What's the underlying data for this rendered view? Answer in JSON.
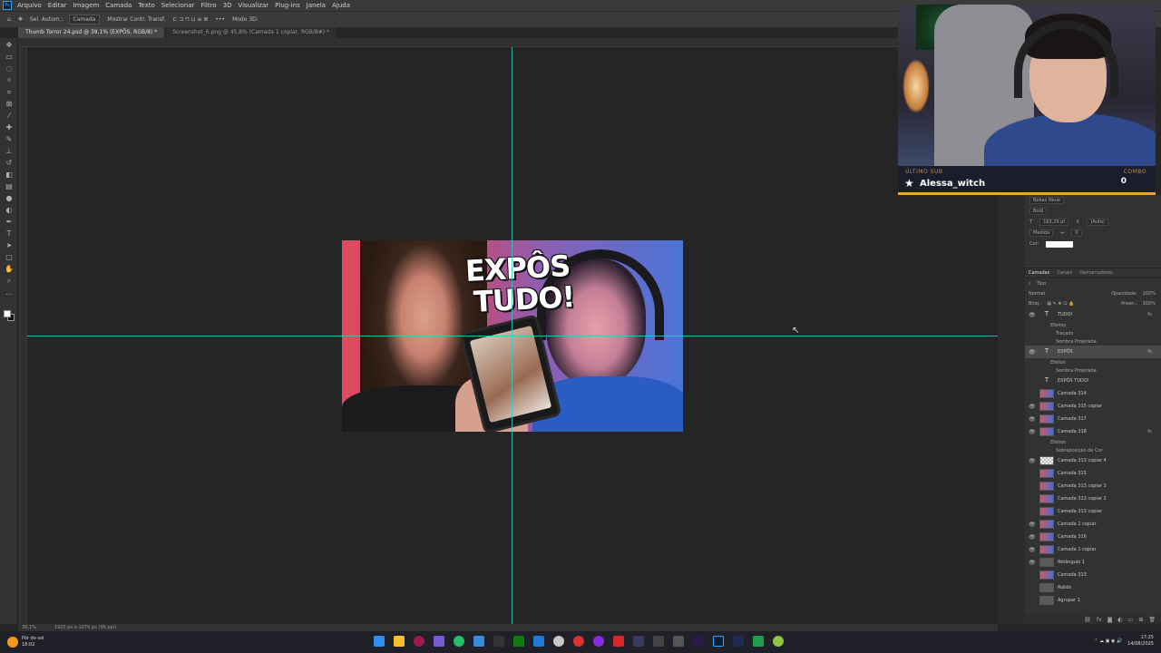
{
  "menubar": {
    "logo": "Ps",
    "items": [
      "Arquivo",
      "Editar",
      "Imagem",
      "Camada",
      "Texto",
      "Selecionar",
      "Filtro",
      "3D",
      "Visualizar",
      "Plug-ins",
      "Janela",
      "Ajuda"
    ]
  },
  "optionsbar": {
    "auto_select": "Sel. Autom.:",
    "auto_select_value": "Camada",
    "show_transform": "Mostrar Contr. Transf.",
    "mode_3d": "Modo 3D:"
  },
  "tabs": [
    {
      "label": "Thumb Torror 24.psd @ 39,1% (EXPÔS, RGB/8) *",
      "active": true
    },
    {
      "label": "Screenshot_6.png @ 45,8% (Camada 1 copiar, RGB/8#) *",
      "active": false
    }
  ],
  "canvas": {
    "headline_line1": "EXPÔS",
    "headline_line2": "TUDO!"
  },
  "statusbar": {
    "zoom": "39,1%",
    "doc_size": "1920 px x 1079 px (96 ppi)"
  },
  "stream_alert": {
    "label": "ÚLTIMO SUB",
    "name": "Alessa_witch",
    "combo_label": "COMBO",
    "combo_value": "0"
  },
  "properties": {
    "font_family": "Bebas Neue",
    "font_style": "Bold",
    "size": "163,29 pt",
    "leading": "(Auto)",
    "tracking_mode": "Medida",
    "tracking": "0",
    "color_label": "Cor:"
  },
  "layers_panel": {
    "tabs": [
      "Camadas",
      "Canais",
      "Demarcadores"
    ],
    "filter": "Tipo",
    "blend_mode": "Normal",
    "opacity_label": "Opacidade:",
    "opacity": "100%",
    "lock_label": "Bloq.:",
    "fill_label": "Preen.:",
    "fill": "100%",
    "layers": [
      {
        "kind": "text",
        "name": "TUDO!",
        "visible": true,
        "fx": true,
        "selected": false
      },
      {
        "kind": "sub",
        "name": "Efeitos"
      },
      {
        "kind": "sub2",
        "name": "Traçado"
      },
      {
        "kind": "sub2",
        "name": "Sombra Projetada"
      },
      {
        "kind": "text",
        "name": "EXPÔS",
        "visible": true,
        "fx": true,
        "selected": true
      },
      {
        "kind": "sub",
        "name": "Efeitos"
      },
      {
        "kind": "sub2",
        "name": "Sombra Projetada"
      },
      {
        "kind": "text",
        "name": "EXPÔS TUDO!",
        "visible": false,
        "fx": false,
        "selected": false
      },
      {
        "kind": "image",
        "name": "Camada 314",
        "visible": false,
        "fx": false,
        "selected": false
      },
      {
        "kind": "image",
        "name": "Camada 315 copiar",
        "visible": true,
        "fx": false,
        "selected": false
      },
      {
        "kind": "image",
        "name": "Camada 317",
        "visible": true,
        "fx": false,
        "selected": false
      },
      {
        "kind": "image",
        "name": "Camada 318",
        "visible": true,
        "fx": true,
        "selected": false
      },
      {
        "kind": "sub",
        "name": "Efeitos"
      },
      {
        "kind": "sub2",
        "name": "Sobreposição de Cor"
      },
      {
        "kind": "checker",
        "name": "Camada 313 copiar 4",
        "visible": true,
        "fx": false,
        "selected": false
      },
      {
        "kind": "image",
        "name": "Camada 315",
        "visible": false,
        "fx": false,
        "selected": false
      },
      {
        "kind": "image",
        "name": "Camada 313 copiar 3",
        "visible": false,
        "fx": false,
        "selected": false
      },
      {
        "kind": "image",
        "name": "Camada 313 copiar 2",
        "visible": false,
        "fx": false,
        "selected": false
      },
      {
        "kind": "image",
        "name": "Camada 313 copiar",
        "visible": false,
        "fx": false,
        "selected": false
      },
      {
        "kind": "image",
        "name": "Camada 1 copiar",
        "visible": true,
        "fx": false,
        "selected": false
      },
      {
        "kind": "image",
        "name": "Camada 316",
        "visible": true,
        "fx": false,
        "selected": false
      },
      {
        "kind": "image",
        "name": "Camada 1 copiar",
        "visible": true,
        "fx": false,
        "selected": false
      },
      {
        "kind": "folder",
        "name": "Retângulo 1",
        "visible": true,
        "fx": false,
        "selected": false
      },
      {
        "kind": "image",
        "name": "Camada 313",
        "visible": false,
        "fx": false,
        "selected": false
      },
      {
        "kind": "group",
        "name": "Robôs",
        "visible": false,
        "fx": false,
        "selected": false
      },
      {
        "kind": "group",
        "name": "Agrupar 1",
        "visible": false,
        "fx": false,
        "selected": false
      }
    ]
  },
  "taskbar": {
    "weather": "Pôr do sol",
    "weather_time": "18:02",
    "time": "17:25",
    "date": "14/08/2025"
  }
}
